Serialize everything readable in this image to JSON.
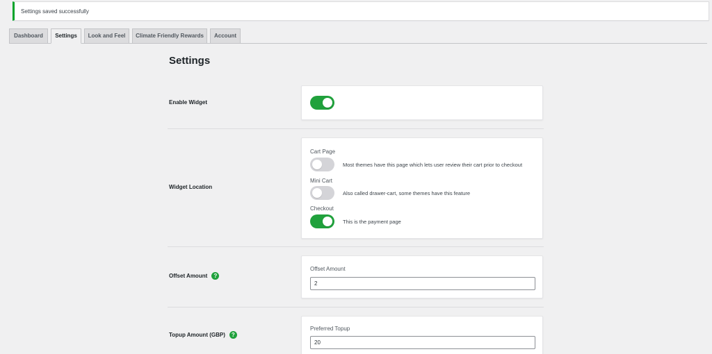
{
  "notice": {
    "text": "Settings saved successfully"
  },
  "tabs": [
    {
      "label": "Dashboard"
    },
    {
      "label": "Settings"
    },
    {
      "label": "Look and Feel"
    },
    {
      "label": "Climate Friendly Rewards"
    },
    {
      "label": "Account"
    }
  ],
  "active_tab": "Settings",
  "page_title": "Settings",
  "enable_widget": {
    "label": "Enable Widget",
    "enabled": true
  },
  "widget_location": {
    "label": "Widget Location",
    "options": [
      {
        "title": "Cart Page",
        "description": "Most themes have this page which lets user review their cart prior to checkout",
        "enabled": false
      },
      {
        "title": "Mini Cart",
        "description": "Also called drawer-cart, some themes have this feature",
        "enabled": false
      },
      {
        "title": "Checkout",
        "description": "This is the payment page",
        "enabled": true
      }
    ]
  },
  "offset_amount": {
    "label": "Offset Amount",
    "field_label": "Offset Amount",
    "value": "2",
    "help_icon": "help-icon"
  },
  "topup_amount": {
    "label": "Topup Amount (GBP)",
    "field_label": "Preferred Topup",
    "value": "20",
    "help_icon": "help-icon"
  },
  "colors": {
    "accent": "#20a13c",
    "notice_border": "#00a32a",
    "background": "#f0f0f1"
  }
}
